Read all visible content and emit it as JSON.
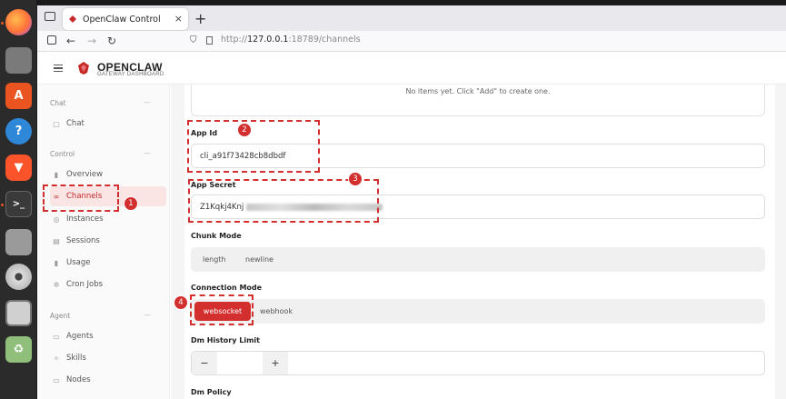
{
  "browser": {
    "tab_title": "OpenClaw Control",
    "url_prefix": "http://",
    "url_host": "127.0.0.1",
    "url_rest": ":18789/channels",
    "tab_close": "×",
    "new_tab": "+",
    "back": "←",
    "forward": "→",
    "reload": "↻"
  },
  "app": {
    "brand": "OPENCLAW",
    "subtitle": "GATEWAY DASHBOARD"
  },
  "sidebar": {
    "sections": [
      {
        "title": "Chat",
        "toggle": "—",
        "items": [
          {
            "label": "Chat",
            "icon": "chat-icon"
          }
        ]
      },
      {
        "title": "Control",
        "toggle": "—",
        "items": [
          {
            "label": "Overview",
            "icon": "bar-chart-icon"
          },
          {
            "label": "Channels",
            "icon": "link-icon",
            "active": true
          },
          {
            "label": "Instances",
            "icon": "radio-icon"
          },
          {
            "label": "Sessions",
            "icon": "document-icon"
          },
          {
            "label": "Usage",
            "icon": "bar-chart-icon"
          },
          {
            "label": "Cron Jobs",
            "icon": "loading-icon"
          }
        ]
      },
      {
        "title": "Agent",
        "toggle": "—",
        "items": [
          {
            "label": "Agents",
            "icon": "folder-icon"
          },
          {
            "label": "Skills",
            "icon": "sparkle-icon"
          },
          {
            "label": "Nodes",
            "icon": "monitor-icon"
          }
        ]
      }
    ]
  },
  "form": {
    "empty_message": "No items yet. Click \"Add\" to create one.",
    "app_id_label": "App Id",
    "app_id_value": "cli_a91f73428cb8dbdf",
    "app_secret_label": "App Secret",
    "app_secret_visible": "Z1Kqkj4Knj",
    "chunk_mode_label": "Chunk Mode",
    "chunk_mode_options": [
      "length",
      "newline"
    ],
    "connection_mode_label": "Connection Mode",
    "connection_mode_options": [
      "websocket",
      "webhook"
    ],
    "connection_mode_selected": "websocket",
    "dm_history_label": "Dm History Limit",
    "dm_history_minus": "−",
    "dm_history_plus": "+",
    "dm_policy_label": "Dm Policy"
  },
  "annotations": [
    "1",
    "2",
    "3",
    "4"
  ],
  "colors": {
    "accent": "#d32f2f",
    "active_bg": "#fbe4e4",
    "dock": "#2b2b2b"
  }
}
